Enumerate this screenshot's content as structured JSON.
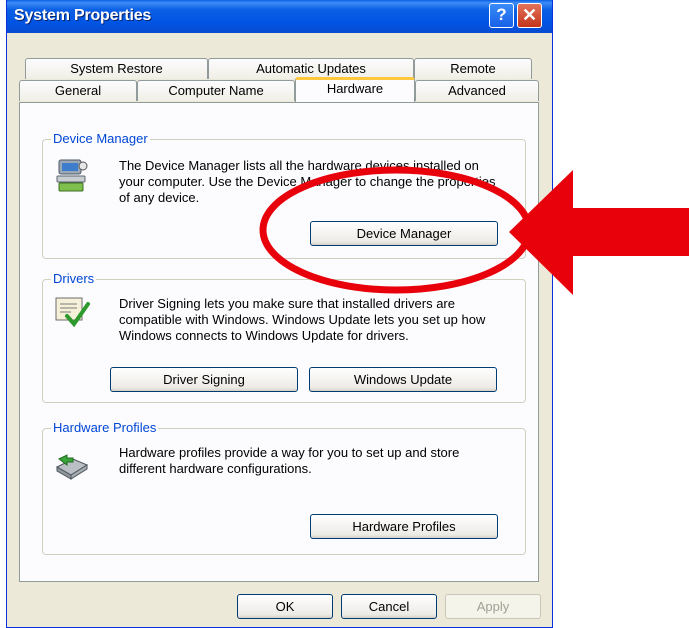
{
  "window": {
    "title": "System Properties",
    "help_glyph": "?",
    "close_glyph": "✕"
  },
  "tabs_row1": [
    "System Restore",
    "Automatic Updates",
    "Remote"
  ],
  "tabs_row2": [
    "General",
    "Computer Name",
    "Hardware",
    "Advanced"
  ],
  "device_manager": {
    "label": "Device Manager",
    "description": "The Device Manager lists all the hardware devices installed on your computer. Use the Device Manager to change the properties of any device.",
    "button": "Device Manager"
  },
  "drivers": {
    "label": "Drivers",
    "description": "Driver Signing lets you make sure that installed drivers are compatible with Windows. Windows Update lets you set up how Windows connects to Windows Update for drivers.",
    "buttons": [
      "Driver Signing",
      "Windows Update"
    ]
  },
  "hardware_profiles": {
    "label": "Hardware Profiles",
    "description": "Hardware profiles provide a way for you to set up and store different hardware configurations.",
    "button": "Hardware Profiles"
  },
  "footer": {
    "ok": "OK",
    "cancel": "Cancel",
    "apply": "Apply"
  },
  "colors": {
    "annotation_red": "#e8000b",
    "title_blue": "#0054e3",
    "group_label_blue": "#0046d5"
  }
}
